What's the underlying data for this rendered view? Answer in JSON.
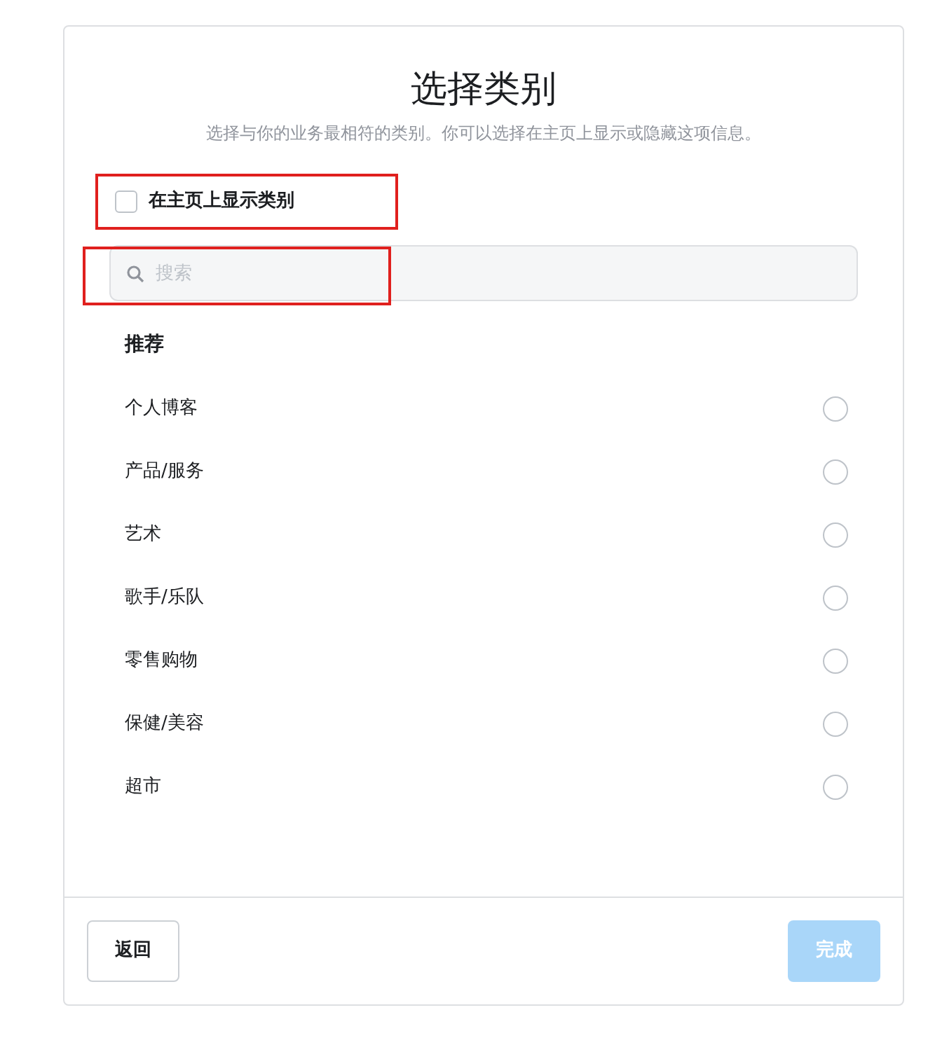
{
  "dialog": {
    "title": "选择类别",
    "subtitle": "选择与你的业务最相符的类别。你可以选择在主页上显示或隐藏这项信息。"
  },
  "show_on_page": {
    "label": "在主页上显示类别",
    "checked": false,
    "highlighted": true
  },
  "search": {
    "placeholder": "搜索",
    "highlighted": true
  },
  "section_title": "推荐",
  "categories": [
    {
      "label": "个人博客",
      "selected": false
    },
    {
      "label": "产品/服务",
      "selected": false
    },
    {
      "label": "艺术",
      "selected": false
    },
    {
      "label": "歌手/乐队",
      "selected": false
    },
    {
      "label": "零售购物",
      "selected": false
    },
    {
      "label": "保健/美容",
      "selected": false
    },
    {
      "label": "超市",
      "selected": false
    }
  ],
  "buttons": {
    "back": {
      "label": "返回",
      "disabled": false
    },
    "done": {
      "label": "完成",
      "disabled": true
    }
  }
}
